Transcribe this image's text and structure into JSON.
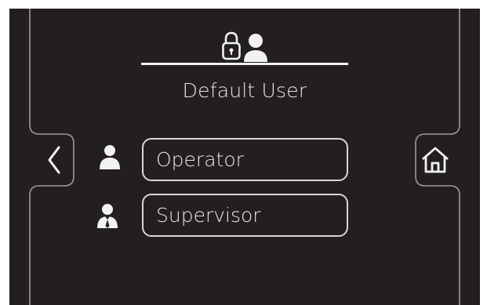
{
  "screen": {
    "title": "Default User",
    "header_icon": "lock-user-icon",
    "back_icon": "chevron-left-icon",
    "home_icon": "home-icon"
  },
  "roles": [
    {
      "label": "Operator",
      "icon": "user-icon"
    },
    {
      "label": "Supervisor",
      "icon": "supervisor-icon"
    }
  ],
  "colors": {
    "background": "#231f20",
    "foreground": "#e6e6e6",
    "outline": "#d7d7d7"
  }
}
